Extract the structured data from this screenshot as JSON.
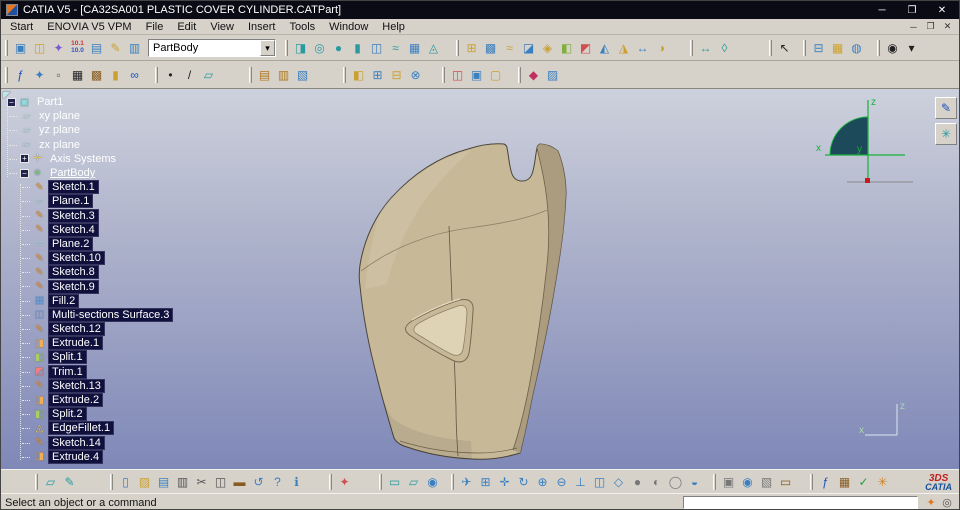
{
  "window": {
    "title": "CATIA V5 - [CA32SA001 PLASTIC COVER CYLINDER.CATPart]",
    "controls": {
      "minimize": "─",
      "maximize": "❐",
      "close": "✕"
    }
  },
  "menubar": {
    "items": [
      "Start",
      "ENOVIA V5 VPM",
      "File",
      "Edit",
      "View",
      "Insert",
      "Tools",
      "Window",
      "Help"
    ],
    "mdi_controls": [
      {
        "name": "mdi-minimize-button",
        "glyph": "─"
      },
      {
        "name": "mdi-restore-button",
        "glyph": "❐"
      },
      {
        "name": "mdi-close-button",
        "glyph": "✕"
      }
    ]
  },
  "combo": {
    "value": "PartBody"
  },
  "toolbar_top1": [
    {
      "icons": [
        {
          "n": "er-workbench-icon",
          "g": "▣",
          "c": "#3a7fc0"
        },
        {
          "n": "er-open-icon",
          "g": "◫",
          "c": "#caa030"
        },
        {
          "n": "pin-document-icon",
          "g": "✦",
          "c": "#7a5ad0"
        },
        {
          "n": "version-icon",
          "g": "10.1",
          "c": "#d03030",
          "g2": "10.0",
          "c2": "#3050d0"
        },
        {
          "n": "vpm-database-icon",
          "g": "▤",
          "c": "#3a7fc0"
        },
        {
          "n": "vpm-pencil-icon",
          "g": "✎",
          "c": "#caa030"
        },
        {
          "n": "vpm-save-icon",
          "g": "▥",
          "c": "#3a7fc0"
        }
      ]
    },
    {
      "combo": true
    },
    {
      "gap": 4,
      "icons": [
        {
          "n": "extrude-surface-icon",
          "g": "◨",
          "c": "#2a9aa0"
        },
        {
          "n": "revolve-surface-icon",
          "g": "◎",
          "c": "#2a9aa0"
        },
        {
          "n": "sphere-surface-icon",
          "g": "●",
          "c": "#2a9aa0"
        },
        {
          "n": "cylinder-surface-icon",
          "g": "▮",
          "c": "#2a9aa0"
        },
        {
          "n": "offset-surface-icon",
          "g": "◫",
          "c": "#3a7fc0"
        },
        {
          "n": "sweep-surface-icon",
          "g": "≈",
          "c": "#2a9aa0"
        },
        {
          "n": "fill-surface-icon",
          "g": "▦",
          "c": "#3a7fc0"
        },
        {
          "n": "blend-surface-icon",
          "g": "◬",
          "c": "#2a9aa0"
        }
      ]
    },
    {
      "gap": 12,
      "icons": [
        {
          "n": "join-icon",
          "g": "⊞",
          "c": "#caa030"
        },
        {
          "n": "healing-icon",
          "g": "▩",
          "c": "#3a7fc0"
        },
        {
          "n": "curve-smooth-icon",
          "g": "≈",
          "c": "#caa030"
        },
        {
          "n": "surface-simplify-icon",
          "g": "◪",
          "c": "#3a7fc0"
        },
        {
          "n": "disassemble-icon",
          "g": "◈",
          "c": "#caa030"
        },
        {
          "n": "split-icon",
          "g": "◧",
          "c": "#80b040"
        },
        {
          "n": "trim-icon",
          "g": "◩",
          "c": "#d05050"
        },
        {
          "n": "boundary-icon",
          "g": "◭",
          "c": "#3a7fc0"
        },
        {
          "n": "extract-icon",
          "g": "◮",
          "c": "#caa030"
        },
        {
          "n": "translate-icon",
          "g": "↔",
          "c": "#3a7fc0"
        },
        {
          "n": "symmetry-icon",
          "g": "◑",
          "c": "#caa030"
        }
      ]
    },
    {
      "gap": 18,
      "icons": [
        {
          "n": "measure-between-icon",
          "g": "↔",
          "c": "#2a9aa0"
        },
        {
          "n": "measure-item-icon",
          "g": "◊",
          "c": "#2a9aa0"
        }
      ]
    },
    {
      "gap": 34,
      "icons": [
        {
          "n": "select-arrow-icon",
          "g": "↖",
          "c": "#222222"
        }
      ]
    },
    {
      "gap": 8,
      "icons": [
        {
          "n": "selection-sets-icon",
          "g": "⊟",
          "c": "#3a7fc0"
        },
        {
          "n": "grid-snap-icon",
          "g": "▦",
          "c": "#caa030"
        },
        {
          "n": "selection-filter-icon",
          "g": "◍",
          "c": "#3a7fc0"
        }
      ]
    },
    {
      "gap": 10,
      "icons": [
        {
          "n": "magnifier-icon",
          "g": "◉",
          "c": "#222222"
        },
        {
          "n": "toolbar-options-icon",
          "g": "▾",
          "c": "#222222"
        }
      ]
    }
  ],
  "toolbar_top2": [
    {
      "icons": [
        {
          "n": "formula-icon",
          "g": "ƒ",
          "c": "#2050c0"
        },
        {
          "n": "knowledge-search-icon",
          "g": "✦",
          "c": "#3a7fc0"
        },
        {
          "n": "publication-icon",
          "g": "▫",
          "c": "#666666"
        },
        {
          "n": "design-table-icon",
          "g": "▦",
          "c": "#222222"
        },
        {
          "n": "catalog-table-icon",
          "g": "▩",
          "c": "#8a5a20"
        },
        {
          "n": "lock-icon",
          "g": "▮",
          "c": "#caa030"
        },
        {
          "n": "parameters-icon",
          "g": "∞",
          "c": "#2050c0"
        }
      ]
    },
    {
      "gap": 10,
      "icons": [
        {
          "n": "point-icon",
          "g": "•",
          "c": "#222222"
        },
        {
          "n": "line-icon",
          "g": "/",
          "c": "#222222"
        },
        {
          "n": "plane-icon",
          "g": "▱",
          "c": "#2a9aa0"
        }
      ]
    },
    {
      "gap": 30,
      "icons": [
        {
          "n": "catalog-icon",
          "g": "▤",
          "c": "#b07820"
        },
        {
          "n": "library-icon",
          "g": "▥",
          "c": "#b07820"
        },
        {
          "n": "mask-icon",
          "g": "▧",
          "c": "#3a7fc0"
        }
      ]
    },
    {
      "gap": 30,
      "icons": [
        {
          "n": "assemble-icon",
          "g": "◧",
          "c": "#caa030"
        },
        {
          "n": "add-body-icon",
          "g": "⊞",
          "c": "#3a7fc0"
        },
        {
          "n": "remove-body-icon",
          "g": "⊟",
          "c": "#caa030"
        },
        {
          "n": "intersect-body-icon",
          "g": "⊗",
          "c": "#3a7fc0"
        }
      ]
    },
    {
      "gap": 16,
      "icons": [
        {
          "n": "sew-surface-icon",
          "g": "◫",
          "c": "#d05050"
        },
        {
          "n": "thick-surface-icon",
          "g": "▣",
          "c": "#3a7fc0"
        },
        {
          "n": "close-surface-icon",
          "g": "▢",
          "c": "#caa030"
        }
      ]
    },
    {
      "gap": 12,
      "icons": [
        {
          "n": "apply-material-icon",
          "g": "◆",
          "c": "#c03060"
        },
        {
          "n": "graphic-properties-icon",
          "g": "▨",
          "c": "#3a7fc0"
        }
      ]
    }
  ],
  "toolbar_bottom": [
    {
      "gap": 30,
      "icons": [
        {
          "n": "plane-tool-icon",
          "g": "▱",
          "c": "#2a9aa0"
        },
        {
          "n": "sketcher-icon",
          "g": "✎",
          "c": "#2a9aa0"
        }
      ]
    },
    {
      "gap": 30,
      "icons": [
        {
          "n": "new-icon",
          "g": "▯",
          "c": "#3a7fc0"
        },
        {
          "n": "open-icon",
          "g": "▨",
          "c": "#caa030"
        },
        {
          "n": "save-icon",
          "g": "▤",
          "c": "#3a7fc0"
        },
        {
          "n": "print-icon",
          "g": "▥",
          "c": "#555555"
        },
        {
          "n": "cut-icon",
          "g": "✂",
          "c": "#555555"
        },
        {
          "n": "copy-icon",
          "g": "◫",
          "c": "#555555"
        },
        {
          "n": "paste-icon",
          "g": "▬",
          "c": "#8a5a20"
        },
        {
          "n": "undo-icon",
          "g": "↺",
          "c": "#3a7fc0"
        },
        {
          "n": "help-icon",
          "g": "?",
          "c": "#3a7fc0"
        },
        {
          "n": "whats-this-icon",
          "g": "ℹ",
          "c": "#3a7fc0"
        }
      ]
    },
    {
      "gap": 22,
      "icons": [
        {
          "n": "power-copy-icon",
          "g": "✦",
          "c": "#d05050"
        }
      ]
    },
    {
      "gap": 24,
      "icons": [
        {
          "n": "datum-icon",
          "g": "▭",
          "c": "#2a9aa0"
        },
        {
          "n": "positioned-sketch-icon",
          "g": "▱",
          "c": "#2a9aa0"
        },
        {
          "n": "analysis-icon",
          "g": "◉",
          "c": "#3a7fc0"
        }
      ]
    },
    {
      "gap": 8,
      "icons": [
        {
          "n": "fly-mode-icon",
          "g": "✈",
          "c": "#3a7fc0"
        },
        {
          "n": "fit-all-icon",
          "g": "⊞",
          "c": "#3a7fc0"
        },
        {
          "n": "pan-icon",
          "g": "✛",
          "c": "#3a7fc0"
        },
        {
          "n": "rotate-icon",
          "g": "↻",
          "c": "#3a7fc0"
        },
        {
          "n": "zoom-in-icon",
          "g": "⊕",
          "c": "#3a7fc0"
        },
        {
          "n": "zoom-out-icon",
          "g": "⊖",
          "c": "#3a7fc0"
        },
        {
          "n": "normal-view-icon",
          "g": "⊥",
          "c": "#3a7fc0"
        },
        {
          "n": "multi-view-icon",
          "g": "◫",
          "c": "#3a7fc0"
        },
        {
          "n": "iso-view-icon",
          "g": "◇",
          "c": "#3a7fc0"
        },
        {
          "n": "shading-icon",
          "g": "●",
          "c": "#777777"
        },
        {
          "n": "shading-edges-icon",
          "g": "◐",
          "c": "#777777"
        },
        {
          "n": "wireframe-icon",
          "g": "◯",
          "c": "#777777"
        },
        {
          "n": "hide-show-icon",
          "g": "◒",
          "c": "#3a7fc0"
        }
      ]
    },
    {
      "gap": 8,
      "icons": [
        {
          "n": "view-mode-icon",
          "g": "▣",
          "c": "#777777"
        },
        {
          "n": "magnify-view-icon",
          "g": "◉",
          "c": "#3a7fc0"
        },
        {
          "n": "depth-effect-icon",
          "g": "▧",
          "c": "#777777"
        },
        {
          "n": "ground-icon",
          "g": "▭",
          "c": "#8a5a20"
        }
      ]
    },
    {
      "gap": 14,
      "icons": [
        {
          "n": "knowledge-formula-icon",
          "g": "ƒ",
          "c": "#2050c0"
        },
        {
          "n": "knowledge-table-icon",
          "g": "▦",
          "c": "#8a5a20"
        },
        {
          "n": "rule-check-icon",
          "g": "✓",
          "c": "#2a9a40"
        },
        {
          "n": "knowledge-inspector-icon",
          "g": "✳",
          "c": "#d08020"
        }
      ]
    }
  ],
  "side_toolbar": [
    {
      "n": "active-workbench-icon",
      "g": "✎",
      "c": "#2050c0"
    },
    {
      "n": "secondary-workbench-icon",
      "g": "✳",
      "c": "#2a9aa0"
    }
  ],
  "tree": {
    "items": [
      {
        "label": "Part1",
        "level": 0,
        "g": "▣",
        "c": "#8fd8dc",
        "icon": "part-icon",
        "exp": "minus"
      },
      {
        "label": "xy plane",
        "level": 1,
        "g": "▱",
        "c": "#bfe6ea",
        "icon": "plane-icon"
      },
      {
        "label": "yz plane",
        "level": 1,
        "g": "▱",
        "c": "#bfe6ea",
        "icon": "plane-icon"
      },
      {
        "label": "zx plane",
        "level": 1,
        "g": "▱",
        "c": "#bfe6ea",
        "icon": "plane-icon"
      },
      {
        "label": "Axis Systems",
        "level": 1,
        "g": "✛",
        "c": "#e8d060",
        "icon": "axis-systems-icon",
        "exp": "plus"
      },
      {
        "label": "PartBody",
        "level": 1,
        "g": "✳",
        "c": "#6fd06f",
        "icon": "partbody-icon",
        "exp": "minus",
        "underline": true
      },
      {
        "label": "Sketch.1",
        "level": 2,
        "g": "✎",
        "c": "#f0a040",
        "icon": "sketch-icon",
        "selected": true
      },
      {
        "label": "Plane.1",
        "level": 2,
        "g": "▱",
        "c": "#bfe6ea",
        "icon": "plane-icon",
        "selected": true
      },
      {
        "label": "Sketch.3",
        "level": 2,
        "g": "✎",
        "c": "#f0a040",
        "icon": "sketch-icon",
        "selected": true
      },
      {
        "label": "Sketch.4",
        "level": 2,
        "g": "✎",
        "c": "#f0a040",
        "icon": "sketch-icon",
        "selected": true
      },
      {
        "label": "Plane.2",
        "level": 2,
        "g": "▱",
        "c": "#bfe6ea",
        "icon": "plane-icon",
        "selected": true
      },
      {
        "label": "Sketch.10",
        "level": 2,
        "g": "✎",
        "c": "#f0a040",
        "icon": "sketch-icon",
        "selected": true
      },
      {
        "label": "Sketch.8",
        "level": 2,
        "g": "✎",
        "c": "#f0a040",
        "icon": "sketch-icon",
        "selected": true
      },
      {
        "label": "Sketch.9",
        "level": 2,
        "g": "✎",
        "c": "#f0a040",
        "icon": "sketch-icon",
        "selected": true
      },
      {
        "label": "Fill.2",
        "level": 2,
        "g": "▦",
        "c": "#6fa8e8",
        "icon": "fill-icon",
        "selected": true
      },
      {
        "label": "Multi-sections Surface.3",
        "level": 2,
        "g": "◫",
        "c": "#6fa8e8",
        "icon": "multi-sections-surface-icon",
        "selected": true
      },
      {
        "label": "Sketch.12",
        "level": 2,
        "g": "✎",
        "c": "#f0a040",
        "icon": "sketch-icon",
        "selected": true
      },
      {
        "label": "Extrude.1",
        "level": 2,
        "g": "◨",
        "c": "#f0b050",
        "icon": "extrude-icon",
        "selected": true
      },
      {
        "label": "Split.1",
        "level": 2,
        "g": "◧",
        "c": "#a8d060",
        "icon": "split-icon",
        "selected": true
      },
      {
        "label": "Trim.1",
        "level": 2,
        "g": "◩",
        "c": "#f08080",
        "icon": "trim-icon",
        "selected": true
      },
      {
        "label": "Sketch.13",
        "level": 2,
        "g": "✎",
        "c": "#f0a040",
        "icon": "sketch-icon",
        "selected": true
      },
      {
        "label": "Extrude.2",
        "level": 2,
        "g": "◨",
        "c": "#f0b050",
        "icon": "extrude-icon",
        "selected": true
      },
      {
        "label": "Split.2",
        "level": 2,
        "g": "◧",
        "c": "#a8d060",
        "icon": "split-icon",
        "selected": true
      },
      {
        "label": "EdgeFillet.1",
        "level": 2,
        "g": "◬",
        "c": "#f0d060",
        "icon": "edge-fillet-icon",
        "selected": true
      },
      {
        "label": "Sketch.14",
        "level": 2,
        "g": "✎",
        "c": "#f0a040",
        "icon": "sketch-icon",
        "selected": true
      },
      {
        "label": "Extrude.4",
        "level": 2,
        "g": "◨",
        "c": "#f0b050",
        "icon": "extrude-icon",
        "selected": true
      }
    ]
  },
  "compass": {
    "x": "x",
    "y": "y",
    "z": "z"
  },
  "axis_indicator": {
    "x": "x",
    "z": "z"
  },
  "statusbar": {
    "message": "Select an object or a command",
    "field_value": ""
  },
  "logo": {
    "mark": "3DS",
    "text": "CATIA"
  },
  "colors": {
    "titlebar": "#0b0b16",
    "chrome": "#d6d2ca",
    "viewport_top": "#cdd1dc",
    "viewport_mid": "#a9aec9",
    "viewport_bottom": "#7f88b8",
    "selection_bg": "#10103c",
    "part_main": "#c7b898",
    "part_dark": "#a6977a",
    "part_light": "#ded3b5",
    "compass_green": "#15b03a"
  }
}
